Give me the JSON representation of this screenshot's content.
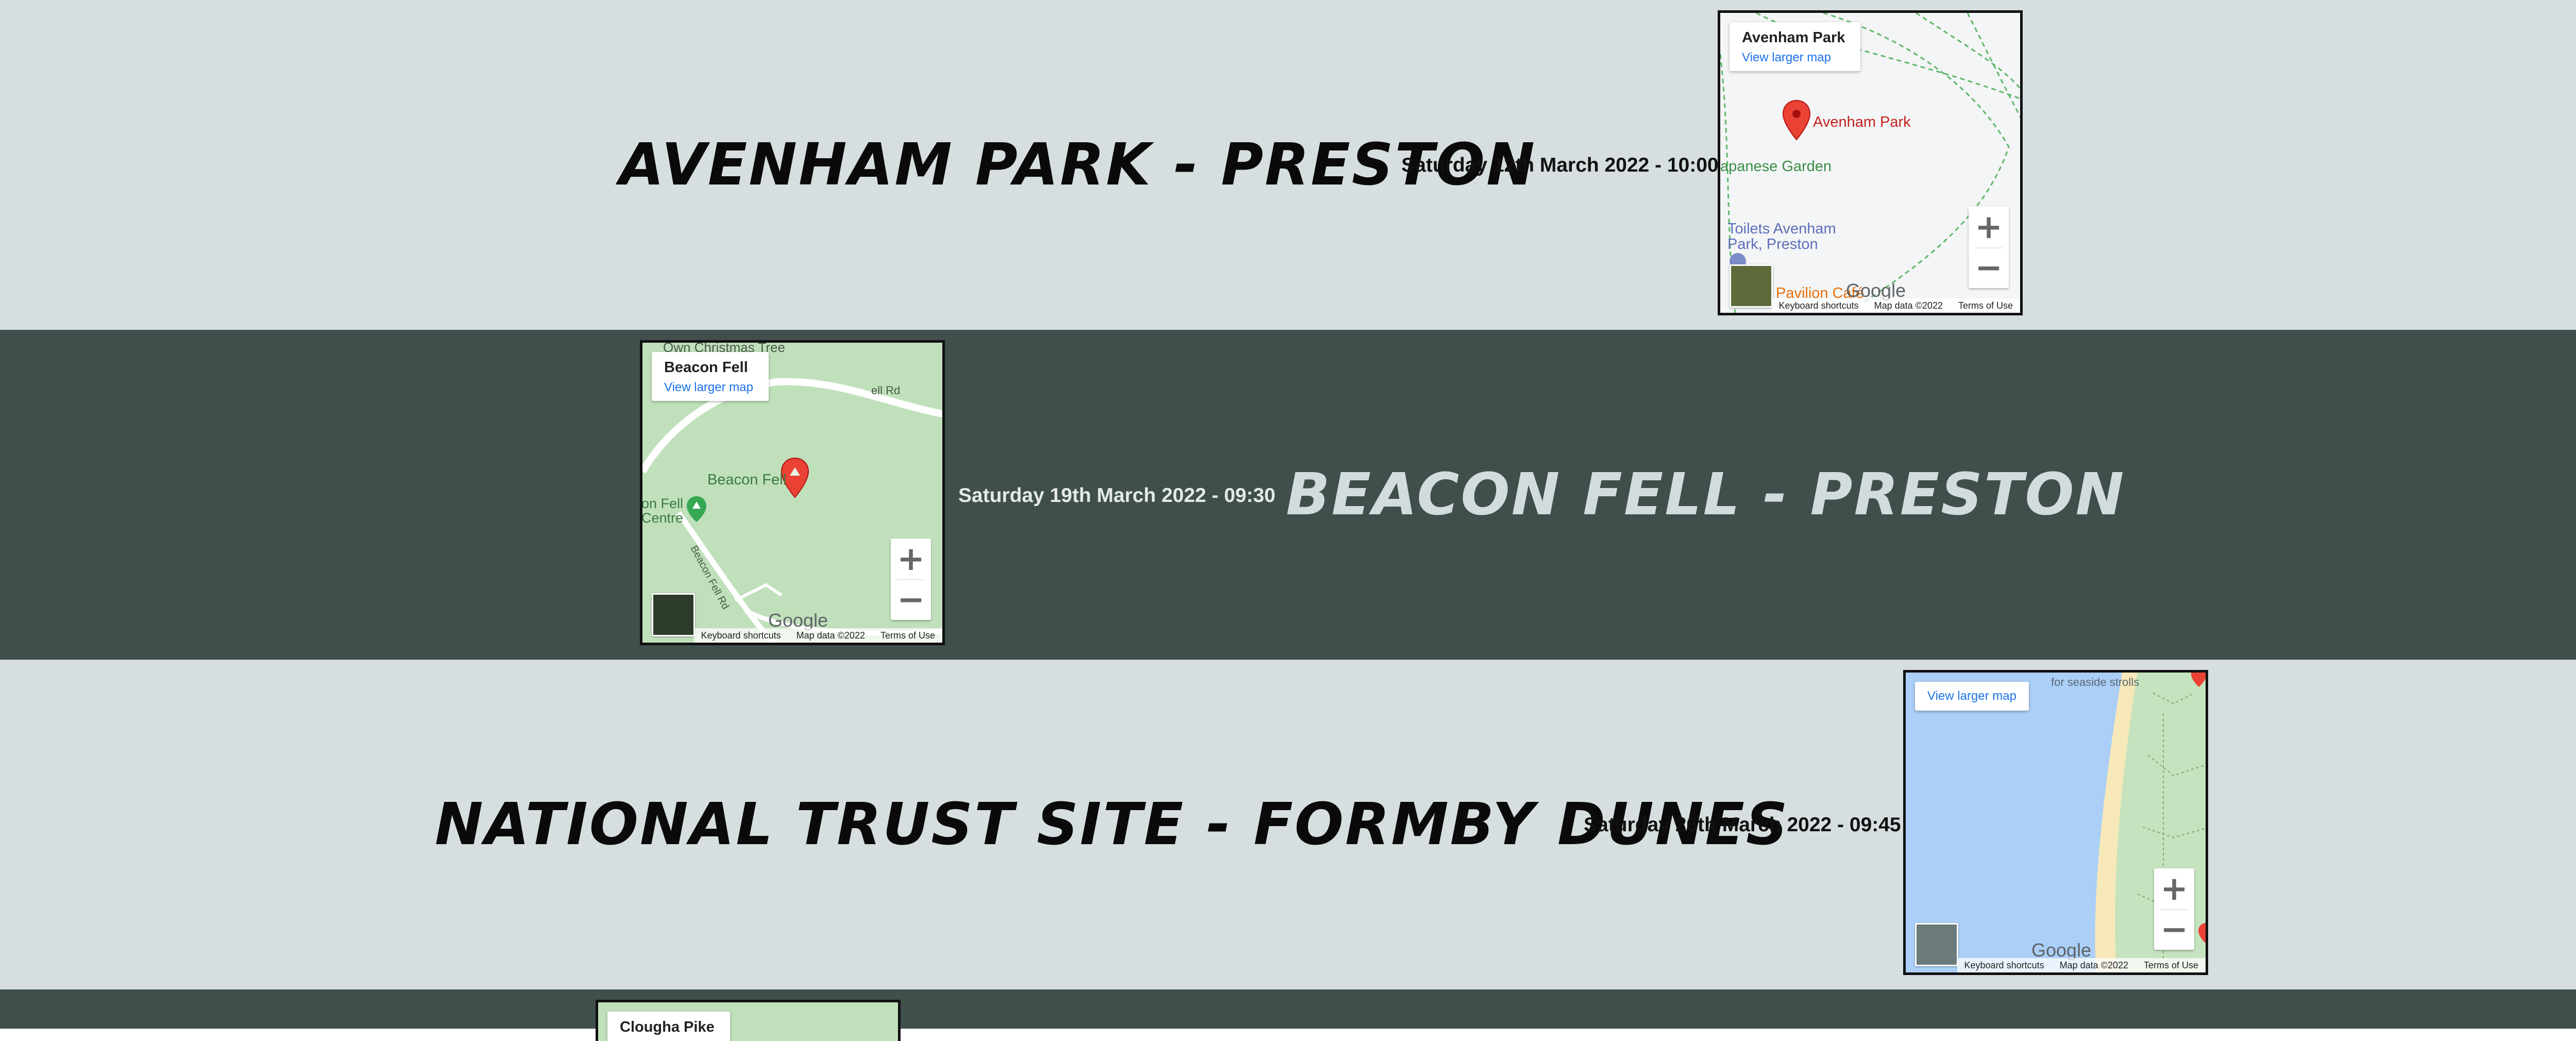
{
  "events": [
    {
      "title": "AVENHAM PARK - PRESTON",
      "date": "Saturday 12th March 2022 - 10:00",
      "map": {
        "place": "Avenham Park",
        "view_larger": "View larger map",
        "pin_label": "Avenham Park",
        "labels": [
          "apanese Garden",
          "Toilets Avenham\nPark, Preston",
          "Pavilion Café"
        ],
        "keyboard": "Keyboard shortcuts",
        "map_data": "Map data ©2022",
        "terms": "Terms of Use",
        "google": "Google"
      }
    },
    {
      "title": "BEACON FELL - PRESTON",
      "date": "Saturday 19th March 2022 - 09:30",
      "map": {
        "place": "Beacon Fell",
        "view_larger": "View larger map",
        "pin_label": "Beacon Fell",
        "labels": [
          "Own Christmas Tree",
          "ell Rd",
          "on Fell\nCentre",
          "Beacon Fell Rd"
        ],
        "keyboard": "Keyboard shortcuts",
        "map_data": "Map data ©2022",
        "terms": "Terms of Use",
        "google": "Google"
      }
    },
    {
      "title": "NATIONAL TRUST SITE - FORMBY DUNES",
      "date": "Saturday 26th March 2022 - 09:45",
      "map": {
        "view_larger": "View larger map",
        "labels": [
          "for seaside strolls"
        ],
        "keyboard": "Keyboard shortcuts",
        "map_data": "Map data ©2022",
        "terms": "Terms of Use",
        "google": "Google"
      }
    },
    {
      "map": {
        "place": "Clougha Pike"
      }
    }
  ],
  "colors": {
    "light_band": "#d6dee0",
    "dark_band": "#404f4b",
    "pin": "#ea4335",
    "link": "#1a73e8"
  }
}
